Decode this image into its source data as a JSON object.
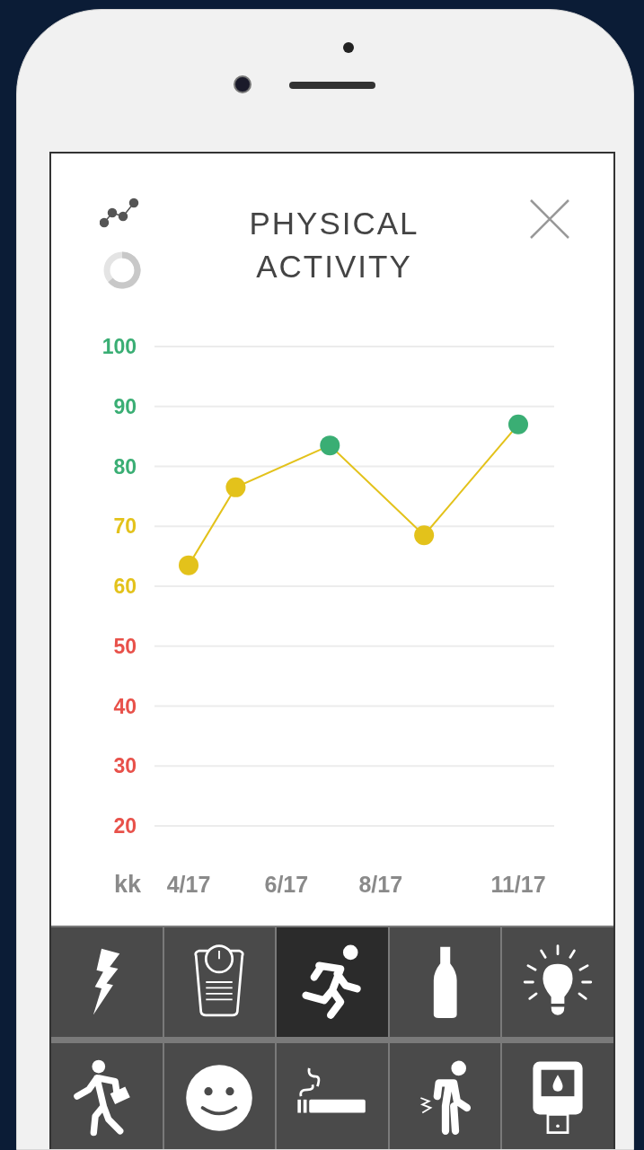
{
  "screen": {
    "title": "PHYSICAL ACTIVITY"
  },
  "chart": {
    "chart_data": {
      "type": "line",
      "ylabel": "kk",
      "grid": true,
      "categories": [
        "4/17",
        null,
        "6/17",
        null,
        "8/17",
        null,
        null,
        "11/17"
      ],
      "series": [
        {
          "color": "#e3c21b",
          "marker": "circle",
          "values": [
            63.5,
            76.5,
            null,
            83.5,
            null,
            68.5,
            null,
            87
          ]
        }
      ],
      "yticks": [
        100,
        90,
        80,
        70,
        60,
        50,
        40,
        30,
        20
      ],
      "ylim": [
        20,
        100
      ]
    }
  },
  "categories": [
    {
      "kind": "lightning",
      "selected": false
    },
    {
      "kind": "scale",
      "selected": false
    },
    {
      "kind": "running",
      "selected": true
    },
    {
      "kind": "bottle",
      "selected": false
    },
    {
      "kind": "bulb",
      "selected": false
    },
    {
      "kind": "walking",
      "selected": false
    },
    {
      "kind": "smiley",
      "selected": false
    },
    {
      "kind": "cigarette",
      "selected": false
    },
    {
      "kind": "pain",
      "selected": false
    },
    {
      "kind": "glucometer",
      "selected": false
    }
  ]
}
